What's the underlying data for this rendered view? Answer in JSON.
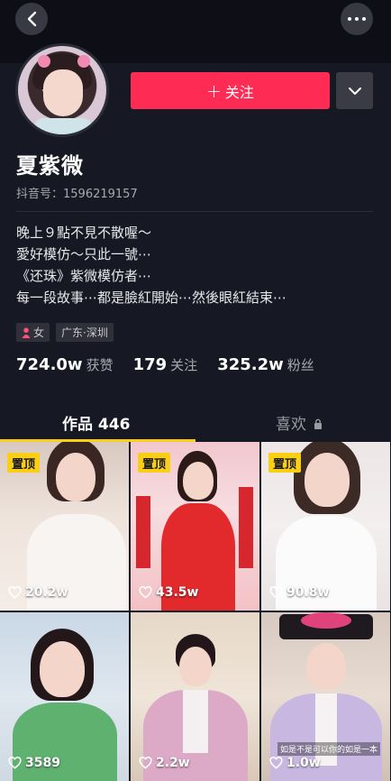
{
  "header": {
    "back_icon": "back-chevron-icon",
    "more_icon": "more-dots-icon"
  },
  "profile": {
    "follow_label": "关注",
    "follow_color": "#fe2c55",
    "name": "夏紫微",
    "douyin_id": "抖音号：1596219157",
    "bio": [
      "晚上９點不見不散喔～",
      "愛好模仿～只此一號⋯",
      "《还珠》紫微模仿者⋯",
      "每一段故事⋯都是臉紅開始⋯然後眼紅結束⋯"
    ],
    "tags": {
      "gender": "女",
      "location": "广东·深圳"
    },
    "stats": [
      {
        "value": "724.0w",
        "label": "获赞"
      },
      {
        "value": "179",
        "label": "关注"
      },
      {
        "value": "325.2w",
        "label": "粉丝"
      }
    ]
  },
  "tabs": {
    "works": "作品 446",
    "likes": "喜欢",
    "accent_color": "#face15"
  },
  "videos": [
    {
      "pinned": "置顶",
      "likes": "20.2w"
    },
    {
      "pinned": "置顶",
      "likes": "43.5w"
    },
    {
      "pinned": "置顶",
      "likes": "90.8w"
    },
    {
      "likes": "3589"
    },
    {
      "likes": "2.2w"
    },
    {
      "likes": "1.0w",
      "caption": "如是不是可以你的如是一本"
    }
  ]
}
